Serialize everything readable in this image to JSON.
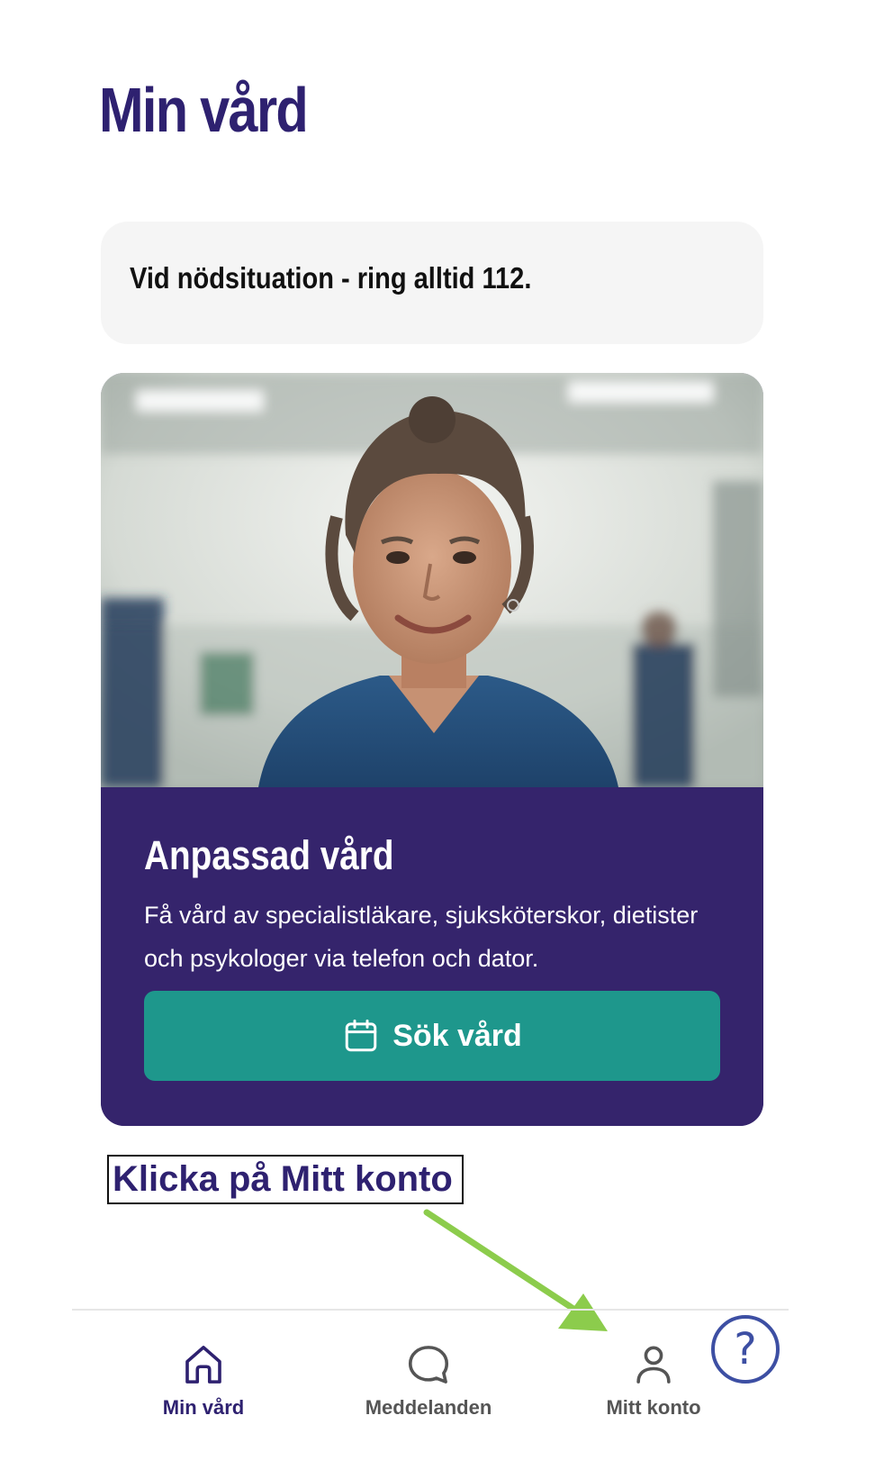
{
  "page": {
    "title": "Min vård"
  },
  "emergency": {
    "text": "Vid nödsituation - ring alltid 112."
  },
  "care_card": {
    "title": "Anpassad vård",
    "description": "Få vård av specialistläkare, sjuksköterskor, dietister och psykologer via telefon och dator.",
    "button_label": "Sök vård",
    "button_icon": "calendar-icon",
    "image": "smiling-nurse-photo"
  },
  "annotation": {
    "instruction": "Klicka på Mitt konto",
    "arrow_color": "#8ccc4c"
  },
  "nav": {
    "items": [
      {
        "label": "Min vård",
        "icon": "home-icon",
        "active": true
      },
      {
        "label": "Meddelanden",
        "icon": "chat-bubble-icon",
        "active": false
      },
      {
        "label": "Mitt konto",
        "icon": "user-icon",
        "active": false
      }
    ],
    "help_glyph": "?"
  },
  "colors": {
    "brand_purple": "#35246c",
    "title_purple": "#2e2170",
    "button_teal": "#1e978c",
    "help_blue": "#3d4fa3",
    "emergency_bg": "#f5f5f5"
  }
}
